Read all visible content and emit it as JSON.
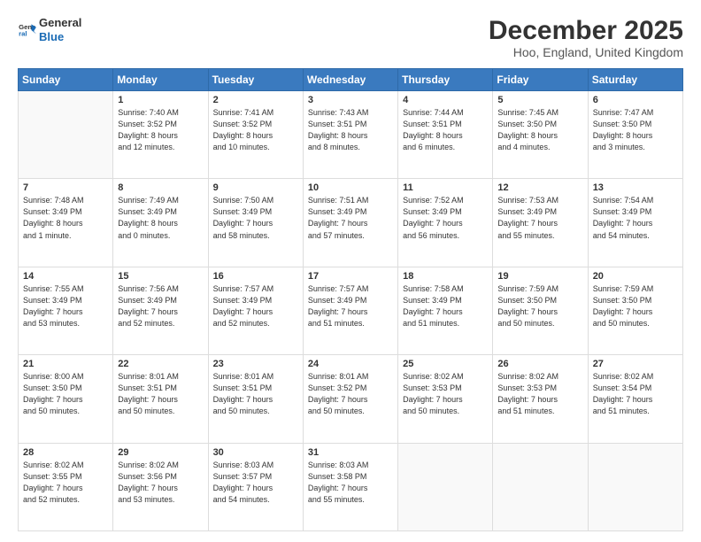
{
  "logo": {
    "line1": "General",
    "line2": "Blue"
  },
  "title": "December 2025",
  "location": "Hoo, England, United Kingdom",
  "weekdays": [
    "Sunday",
    "Monday",
    "Tuesday",
    "Wednesday",
    "Thursday",
    "Friday",
    "Saturday"
  ],
  "weeks": [
    [
      {
        "day": "",
        "info": ""
      },
      {
        "day": "1",
        "info": "Sunrise: 7:40 AM\nSunset: 3:52 PM\nDaylight: 8 hours\nand 12 minutes."
      },
      {
        "day": "2",
        "info": "Sunrise: 7:41 AM\nSunset: 3:52 PM\nDaylight: 8 hours\nand 10 minutes."
      },
      {
        "day": "3",
        "info": "Sunrise: 7:43 AM\nSunset: 3:51 PM\nDaylight: 8 hours\nand 8 minutes."
      },
      {
        "day": "4",
        "info": "Sunrise: 7:44 AM\nSunset: 3:51 PM\nDaylight: 8 hours\nand 6 minutes."
      },
      {
        "day": "5",
        "info": "Sunrise: 7:45 AM\nSunset: 3:50 PM\nDaylight: 8 hours\nand 4 minutes."
      },
      {
        "day": "6",
        "info": "Sunrise: 7:47 AM\nSunset: 3:50 PM\nDaylight: 8 hours\nand 3 minutes."
      }
    ],
    [
      {
        "day": "7",
        "info": "Sunrise: 7:48 AM\nSunset: 3:49 PM\nDaylight: 8 hours\nand 1 minute."
      },
      {
        "day": "8",
        "info": "Sunrise: 7:49 AM\nSunset: 3:49 PM\nDaylight: 8 hours\nand 0 minutes."
      },
      {
        "day": "9",
        "info": "Sunrise: 7:50 AM\nSunset: 3:49 PM\nDaylight: 7 hours\nand 58 minutes."
      },
      {
        "day": "10",
        "info": "Sunrise: 7:51 AM\nSunset: 3:49 PM\nDaylight: 7 hours\nand 57 minutes."
      },
      {
        "day": "11",
        "info": "Sunrise: 7:52 AM\nSunset: 3:49 PM\nDaylight: 7 hours\nand 56 minutes."
      },
      {
        "day": "12",
        "info": "Sunrise: 7:53 AM\nSunset: 3:49 PM\nDaylight: 7 hours\nand 55 minutes."
      },
      {
        "day": "13",
        "info": "Sunrise: 7:54 AM\nSunset: 3:49 PM\nDaylight: 7 hours\nand 54 minutes."
      }
    ],
    [
      {
        "day": "14",
        "info": "Sunrise: 7:55 AM\nSunset: 3:49 PM\nDaylight: 7 hours\nand 53 minutes."
      },
      {
        "day": "15",
        "info": "Sunrise: 7:56 AM\nSunset: 3:49 PM\nDaylight: 7 hours\nand 52 minutes."
      },
      {
        "day": "16",
        "info": "Sunrise: 7:57 AM\nSunset: 3:49 PM\nDaylight: 7 hours\nand 52 minutes."
      },
      {
        "day": "17",
        "info": "Sunrise: 7:57 AM\nSunset: 3:49 PM\nDaylight: 7 hours\nand 51 minutes."
      },
      {
        "day": "18",
        "info": "Sunrise: 7:58 AM\nSunset: 3:49 PM\nDaylight: 7 hours\nand 51 minutes."
      },
      {
        "day": "19",
        "info": "Sunrise: 7:59 AM\nSunset: 3:50 PM\nDaylight: 7 hours\nand 50 minutes."
      },
      {
        "day": "20",
        "info": "Sunrise: 7:59 AM\nSunset: 3:50 PM\nDaylight: 7 hours\nand 50 minutes."
      }
    ],
    [
      {
        "day": "21",
        "info": "Sunrise: 8:00 AM\nSunset: 3:50 PM\nDaylight: 7 hours\nand 50 minutes."
      },
      {
        "day": "22",
        "info": "Sunrise: 8:01 AM\nSunset: 3:51 PM\nDaylight: 7 hours\nand 50 minutes."
      },
      {
        "day": "23",
        "info": "Sunrise: 8:01 AM\nSunset: 3:51 PM\nDaylight: 7 hours\nand 50 minutes."
      },
      {
        "day": "24",
        "info": "Sunrise: 8:01 AM\nSunset: 3:52 PM\nDaylight: 7 hours\nand 50 minutes."
      },
      {
        "day": "25",
        "info": "Sunrise: 8:02 AM\nSunset: 3:53 PM\nDaylight: 7 hours\nand 50 minutes."
      },
      {
        "day": "26",
        "info": "Sunrise: 8:02 AM\nSunset: 3:53 PM\nDaylight: 7 hours\nand 51 minutes."
      },
      {
        "day": "27",
        "info": "Sunrise: 8:02 AM\nSunset: 3:54 PM\nDaylight: 7 hours\nand 51 minutes."
      }
    ],
    [
      {
        "day": "28",
        "info": "Sunrise: 8:02 AM\nSunset: 3:55 PM\nDaylight: 7 hours\nand 52 minutes."
      },
      {
        "day": "29",
        "info": "Sunrise: 8:02 AM\nSunset: 3:56 PM\nDaylight: 7 hours\nand 53 minutes."
      },
      {
        "day": "30",
        "info": "Sunrise: 8:03 AM\nSunset: 3:57 PM\nDaylight: 7 hours\nand 54 minutes."
      },
      {
        "day": "31",
        "info": "Sunrise: 8:03 AM\nSunset: 3:58 PM\nDaylight: 7 hours\nand 55 minutes."
      },
      {
        "day": "",
        "info": ""
      },
      {
        "day": "",
        "info": ""
      },
      {
        "day": "",
        "info": ""
      }
    ]
  ]
}
